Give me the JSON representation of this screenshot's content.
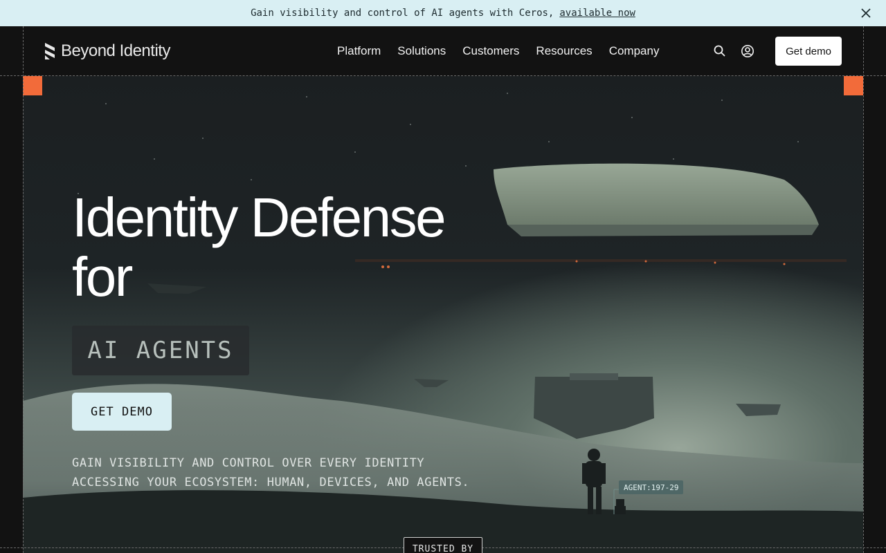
{
  "announcement": {
    "text": "Gain visibility and control of AI agents with Ceros,",
    "link": "available now",
    "close_icon": "close-icon"
  },
  "nav": {
    "logo_text": "Beyond Identity",
    "logo_icon": "beyond-identity-logo-icon",
    "items": [
      "Platform",
      "Solutions",
      "Customers",
      "Resources",
      "Company"
    ],
    "search_icon": "search-icon",
    "account_icon": "user-circle-icon",
    "cta": "Get demo"
  },
  "hero": {
    "title_line1": "Identity Defense",
    "title_line2": "for",
    "rotating_tag": "AI AGENTS",
    "cta": "GET DEMO",
    "subtitle_line1": "GAIN VISIBILITY AND CONTROL OVER EVERY IDENTITY",
    "subtitle_line2": "ACCESSING YOUR ECOSYSTEM: HUMAN, DEVICES, AND AGENTS.",
    "agent_label": "AGENT:197-29"
  },
  "trusted_by": "TRUSTED BY",
  "colors": {
    "announcement_bg": "#d9eff3",
    "page_bg": "#121212",
    "accent_orange": "#f26b3a",
    "cta_bg": "#d9eff3"
  }
}
